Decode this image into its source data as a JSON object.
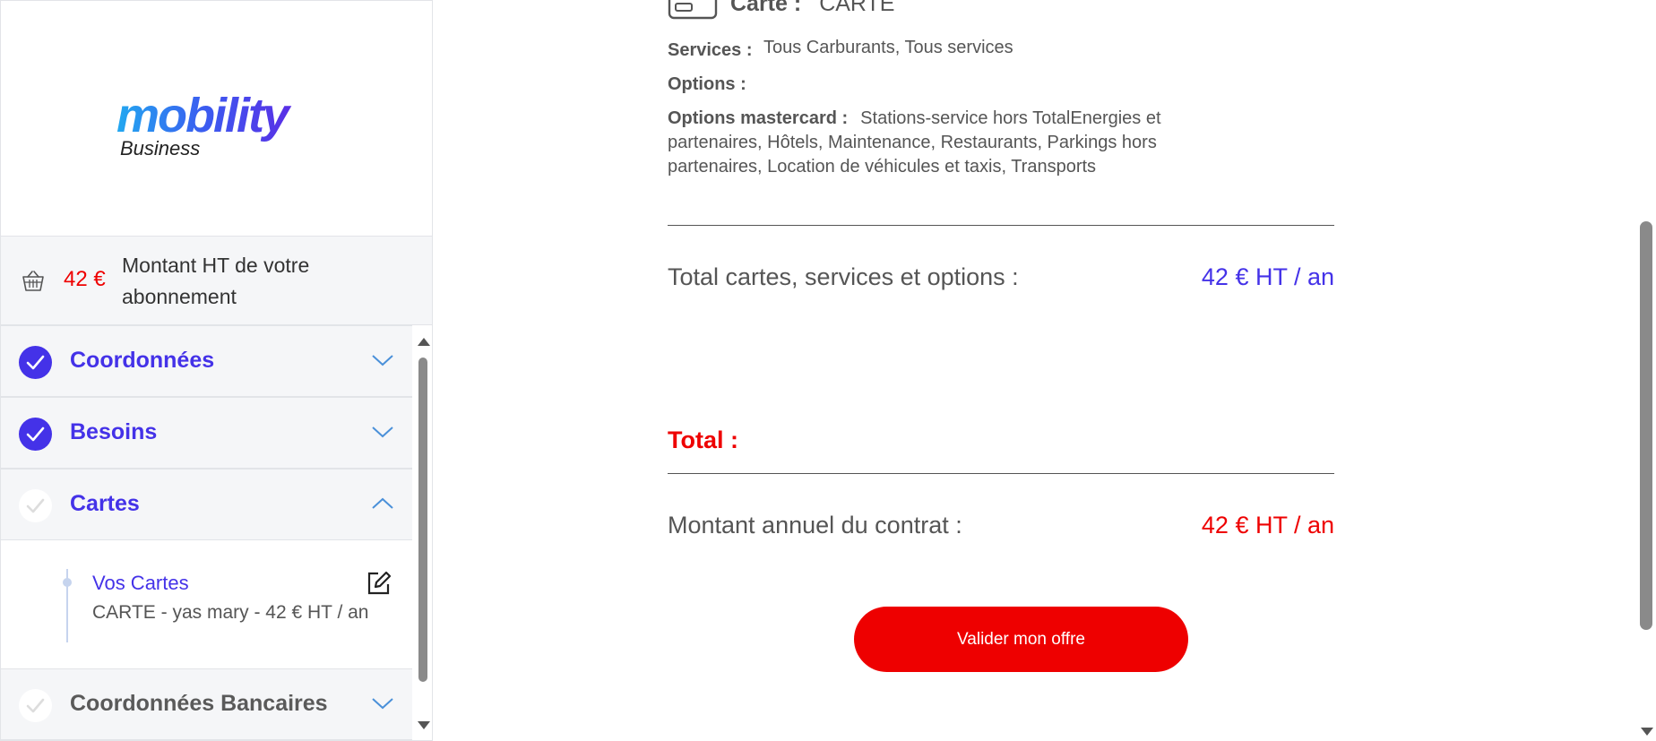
{
  "brand": {
    "logo_word": "mobility",
    "logo_sub": "Business"
  },
  "summary": {
    "amount": "42 €",
    "label": "Montant HT de votre abonnement"
  },
  "steps": [
    {
      "label": "Coordonnées",
      "status": "done",
      "expanded": false
    },
    {
      "label": "Besoins",
      "status": "done",
      "expanded": false
    },
    {
      "label": "Cartes",
      "status": "todo",
      "expanded": true
    },
    {
      "label": "Coordonnées Bancaires",
      "status": "todo",
      "expanded": false
    }
  ],
  "cards": {
    "title": "Vos Cartes",
    "desc": "CARTE - yas mary - 42 € HT / an"
  },
  "detail": {
    "card_key": "Carte :",
    "card_value": "CARTE",
    "services_key": "Services :",
    "services_value": "Tous Carburants, Tous services",
    "options_key": "Options :",
    "mc_key": "Options mastercard :",
    "mc_value": "Stations-service hors TotalEnergies et partenaires, Hôtels, Maintenance, Restaurants, Parkings hors partenaires, Location de véhicules et taxis, Transports"
  },
  "totals": {
    "subtotal_label": "Total cartes, services et options :",
    "subtotal_value": "42 € HT / an",
    "grand_label": "Total :",
    "annual_label": "Montant annuel du contrat :",
    "annual_value": "42 € HT / an"
  },
  "actions": {
    "validate": "Valider mon offre"
  },
  "colors": {
    "brand": "#4432e8",
    "accent": "#ee0000"
  }
}
